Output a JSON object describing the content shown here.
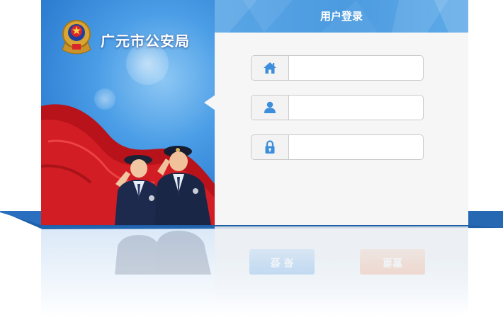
{
  "brand": {
    "title": "广元市公安局"
  },
  "login": {
    "header_title": "用户登录",
    "fields": [
      {
        "icon": "home-icon",
        "value": "",
        "placeholder": ""
      },
      {
        "icon": "user-icon",
        "value": "",
        "placeholder": ""
      },
      {
        "icon": "lock-icon",
        "value": "",
        "placeholder": ""
      }
    ]
  },
  "reflection": {
    "login_button_label": "登 录",
    "reset_button_label": "重置"
  },
  "colors": {
    "panel_blue": "#2f7fd3",
    "header_blue": "#4c9be0",
    "base_stripe": "#1f5fa8",
    "icon_blue": "#3d8fdc",
    "ribbon_red": "#c8141c"
  }
}
